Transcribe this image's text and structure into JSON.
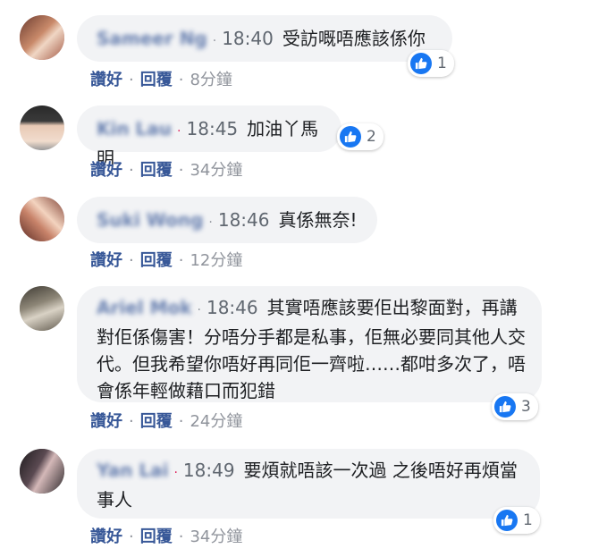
{
  "actions": {
    "like": "讚好",
    "reply": "回覆",
    "separator": "·"
  },
  "comments": [
    {
      "name": "Sameer Ng",
      "time": "18:40",
      "text": "受訪嘅唔應該係你",
      "reactions": "1",
      "ago": "8分鐘"
    },
    {
      "name": "Kin Lau",
      "time": "18:45",
      "text": "加油丫馬明",
      "reactions": "2",
      "ago": "34分鐘"
    },
    {
      "name": "Suki Wong",
      "time": "18:46",
      "text": "真係無奈!",
      "reactions": "",
      "ago": "12分鐘"
    },
    {
      "name": "Ariel Mok",
      "time": "18:46",
      "text": "其實唔應該要佢出黎面對，再講對佢係傷害！分唔分手都是私事，佢無必要同其他人交代。但我希望你唔好再同佢一齊啦……都咁多次了，唔會係年輕做藉口而犯錯",
      "reactions": "3",
      "ago": "24分鐘"
    },
    {
      "name": "Yan Lai",
      "time": "18:49",
      "text": "要煩就唔該一次過 之後唔好再煩當事人",
      "reactions": "1",
      "ago": "34分鐘"
    }
  ],
  "colors": {
    "link": "#385898",
    "bubble": "#f2f3f5",
    "like": "#1877f2"
  }
}
